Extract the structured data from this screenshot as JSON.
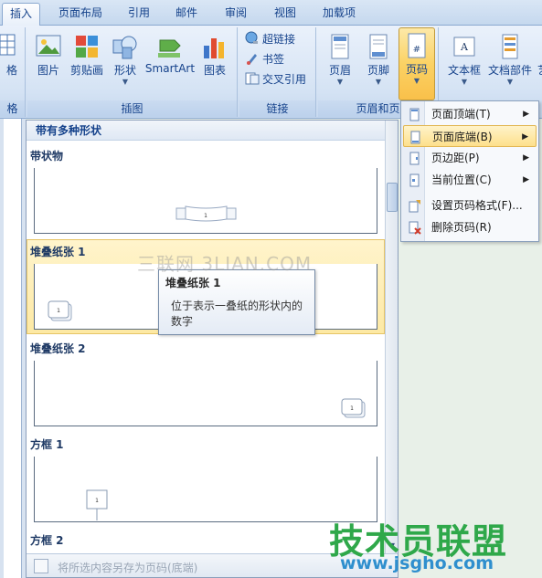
{
  "tabs": [
    {
      "label": "插入",
      "active": true
    },
    {
      "label": "页面布局"
    },
    {
      "label": "引用"
    },
    {
      "label": "邮件"
    },
    {
      "label": "审阅"
    },
    {
      "label": "视图"
    },
    {
      "label": "加载项"
    }
  ],
  "ribbon": {
    "groups": {
      "table_partial": {
        "button": "格",
        "label": "格"
      },
      "illustrations": {
        "label": "插图",
        "buttons": [
          "图片",
          "剪贴画",
          "形状",
          "SmartArt",
          "图表"
        ]
      },
      "links": {
        "label": "链接",
        "buttons": [
          "超链接",
          "书签",
          "交叉引用"
        ]
      },
      "header_footer": {
        "label": "页眉和页",
        "buttons": [
          "页眉",
          "页脚",
          "页码"
        ]
      },
      "text": {
        "buttons": [
          "文本框",
          "文档部件",
          "艺"
        ]
      }
    }
  },
  "gallery": {
    "section_header": "带有多种形状",
    "items": [
      {
        "title": "带状物"
      },
      {
        "title": "堆叠纸张 1",
        "highlighted": true
      },
      {
        "title": "堆叠纸张 2"
      },
      {
        "title": "方框 1"
      },
      {
        "title": "方框 2"
      }
    ],
    "footer": "将所选内容另存为页码(底端)"
  },
  "tooltip": {
    "title": "堆叠纸张 1",
    "description": "位于表示一叠纸的形状内的数字"
  },
  "menu": {
    "items": [
      {
        "label": "页面顶端(T)",
        "submenu": true
      },
      {
        "label": "页面底端(B)",
        "submenu": true,
        "hover": true
      },
      {
        "label": "页边距(P)",
        "submenu": true
      },
      {
        "label": "当前位置(C)",
        "submenu": true
      },
      {
        "label": "设置页码格式(F)..."
      },
      {
        "label": "删除页码(R)"
      }
    ]
  },
  "watermarks": {
    "site1": "三联网 3LIAN.COM",
    "site2": "技术员联盟",
    "site3": "www.jsgho.com"
  },
  "colors": {
    "accent": "#15428b",
    "hover": "#fde08c",
    "brand_green": "#2fa84a"
  }
}
